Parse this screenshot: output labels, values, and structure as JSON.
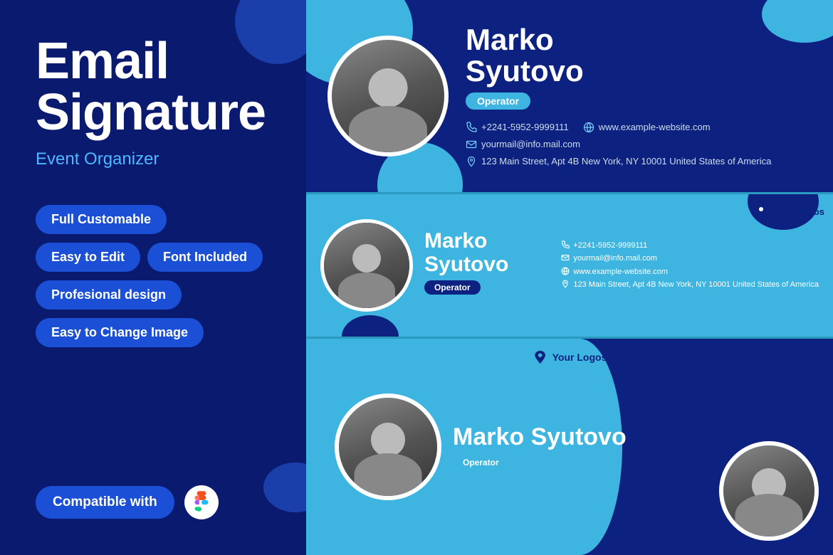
{
  "left": {
    "title_line1": "Email",
    "title_line2": "Signature",
    "subtitle": "Event Organizer",
    "badges": {
      "full_customable": "Full Customable",
      "easy_to_edit": "Easy to Edit",
      "font_included": "Font Included",
      "professional_design": "Profesional design",
      "easy_change_image": "Easy to Change Image",
      "compatible_with": "Compatible with"
    }
  },
  "cards": {
    "card1": {
      "name_line1": "Marko",
      "name_line2": "Syutovo",
      "role": "Operator",
      "phone": "+2241-5952-9999111",
      "email": "yourmail@info.mail.com",
      "website": "www.example-website.com",
      "address": "123 Main Street, Apt 4B New York, NY 10001 United States of America"
    },
    "card2": {
      "name_line1": "Marko",
      "name_line2": "Syutovo",
      "role": "Operator",
      "logo": "Your Logos",
      "phone": "+2241-5952-9999111",
      "email": "yourmail@info.mail.com",
      "website": "www.example-website.com",
      "address": "123 Main Street, Apt 4B New York, NY 10001 United States of America"
    },
    "card3": {
      "name_line1": "Marko Syutovo",
      "role": "Operator",
      "logo": "Your Logos"
    }
  },
  "icons": {
    "phone": "📞",
    "email": "✉",
    "website": "🌐",
    "location": "📍",
    "figma": "F",
    "logo": "🔷"
  }
}
